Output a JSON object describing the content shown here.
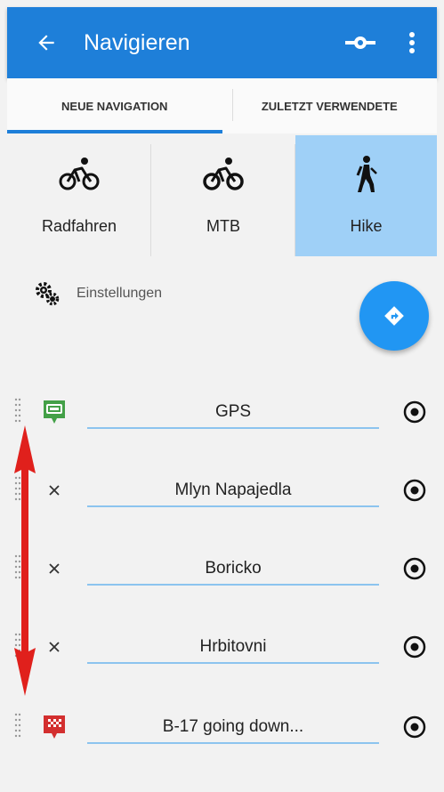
{
  "header": {
    "title": "Navigieren",
    "back_icon": "arrow-left-icon",
    "route_icon": "route-points-icon",
    "menu_icon": "more-vertical-icon"
  },
  "tabs": [
    {
      "label": "NEUE NAVIGATION",
      "active": true
    },
    {
      "label": "ZULETZT VERWENDETE",
      "active": false
    }
  ],
  "modes": [
    {
      "label": "Radfahren",
      "icon": "bicycle-icon",
      "active": false
    },
    {
      "label": "MTB",
      "icon": "mountain-bike-icon",
      "active": false
    },
    {
      "label": "Hike",
      "icon": "hiking-icon",
      "active": true
    }
  ],
  "settings": {
    "label": "Einstellungen",
    "icon": "gears-icon"
  },
  "fab": {
    "icon": "directions-icon"
  },
  "waypoints": [
    {
      "value": "GPS",
      "lead": "gps-start-icon"
    },
    {
      "value": "Mlyn Napajedla",
      "lead": "remove-icon"
    },
    {
      "value": "Boricko",
      "lead": "remove-icon"
    },
    {
      "value": "Hrbitovni",
      "lead": "remove-icon"
    },
    {
      "value": "B-17 going down...",
      "lead": "finish-flag-icon"
    }
  ],
  "colors": {
    "primary": "#1e7fd9",
    "fab": "#2196f3",
    "active_mode": "#9fd0f7",
    "start_green": "#43a047",
    "finish_red": "#d32f2f",
    "annotation_arrow": "#e0201c"
  }
}
